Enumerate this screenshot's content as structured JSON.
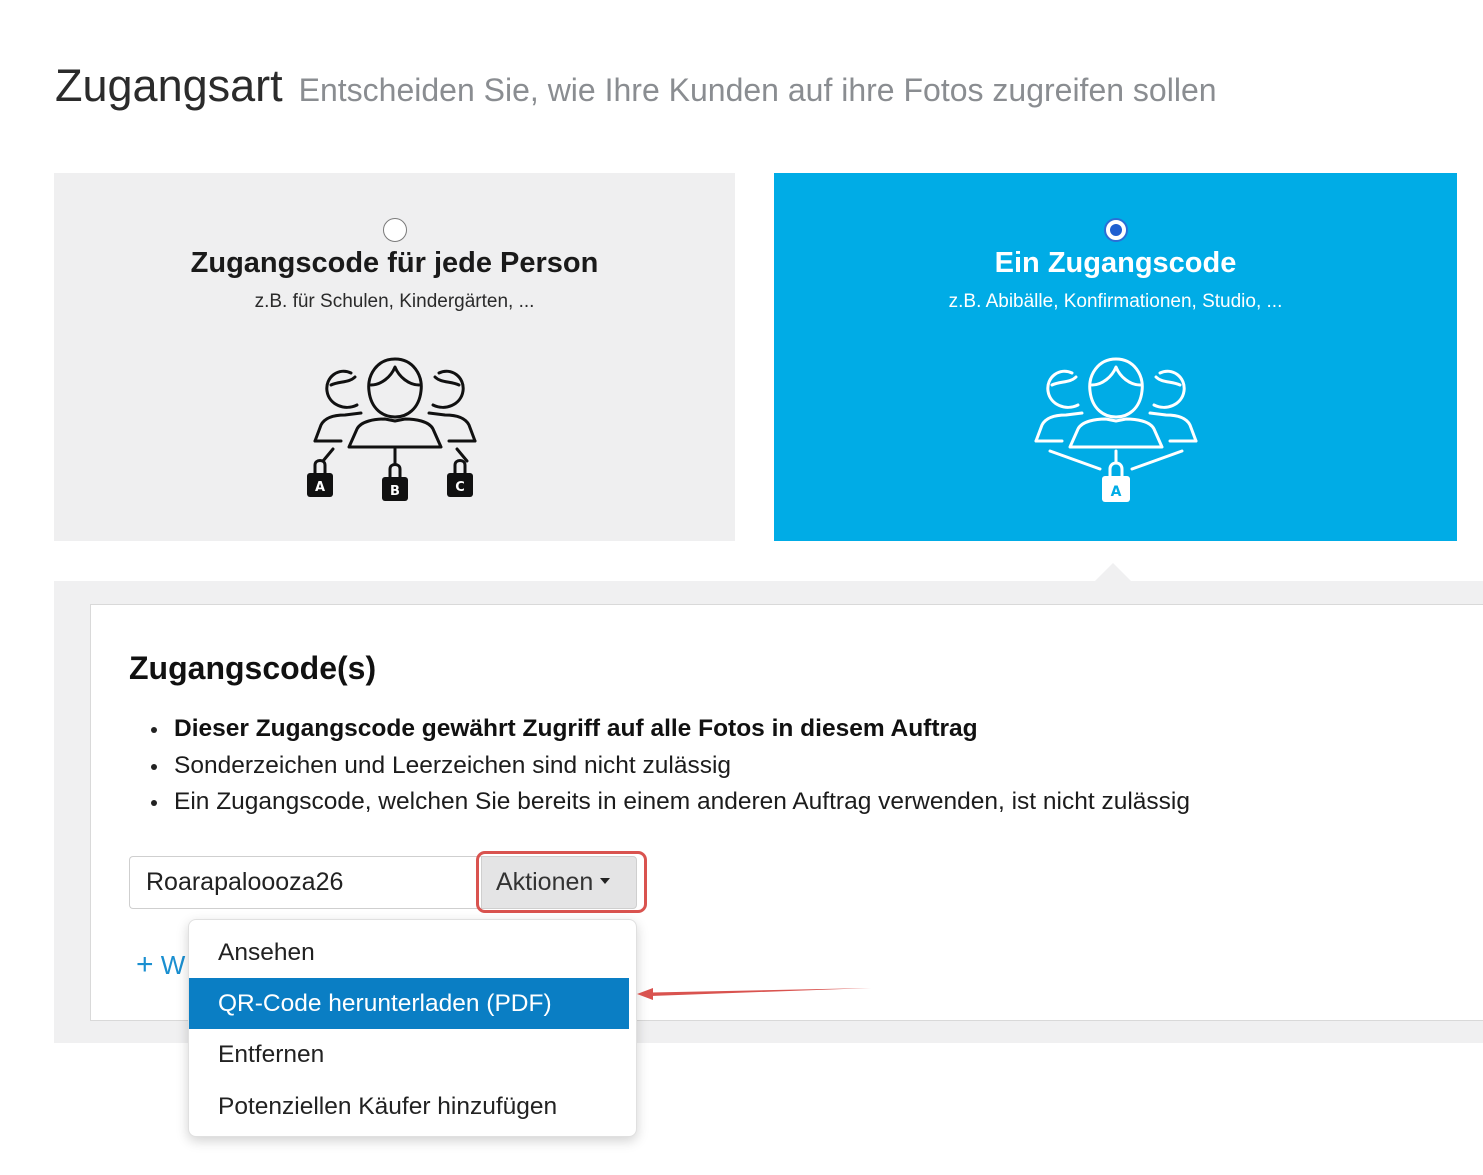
{
  "header": {
    "title": "Zugangsart",
    "subtitle": "Entscheiden Sie, wie Ihre Kunden auf ihre Fotos zugreifen sollen"
  },
  "options": [
    {
      "title": "Zugangscode für jede Person",
      "subtitle": "z.B. für Schulen, Kindergärten, ...",
      "selected": false,
      "lock_labels": [
        "A",
        "B",
        "C"
      ]
    },
    {
      "title": "Ein Zugangscode",
      "subtitle": "z.B. Abibälle, Konfirmationen, Studio, ...",
      "selected": true,
      "lock_labels": [
        "A"
      ]
    }
  ],
  "codes_section": {
    "title": "Zugangscode(s)",
    "rules": [
      "Dieser Zugangscode gewährt Zugriff auf alle Fotos in diesem Auftrag",
      "Sonderzeichen und Leerzeichen sind nicht zulässig",
      "Ein Zugangscode, welchen Sie bereits in einem anderen Auftrag verwenden, ist nicht zulässig"
    ],
    "code_value": "Roarapaloooza26",
    "actions_label": "Aktionen",
    "add_link_plus": "+",
    "add_link_visible": "W"
  },
  "dropdown": {
    "items": [
      "Ansehen",
      "QR-Code herunterladen (PDF)",
      "Entfernen",
      "Potenziellen Käufer hinzufügen"
    ],
    "active_index": 1
  },
  "colors": {
    "selected_card": "#00ace6",
    "card_bg": "#efeff0",
    "dropdown_active": "#0a7ec4",
    "annotation": "#d9534f",
    "link": "#1a8fd0"
  }
}
